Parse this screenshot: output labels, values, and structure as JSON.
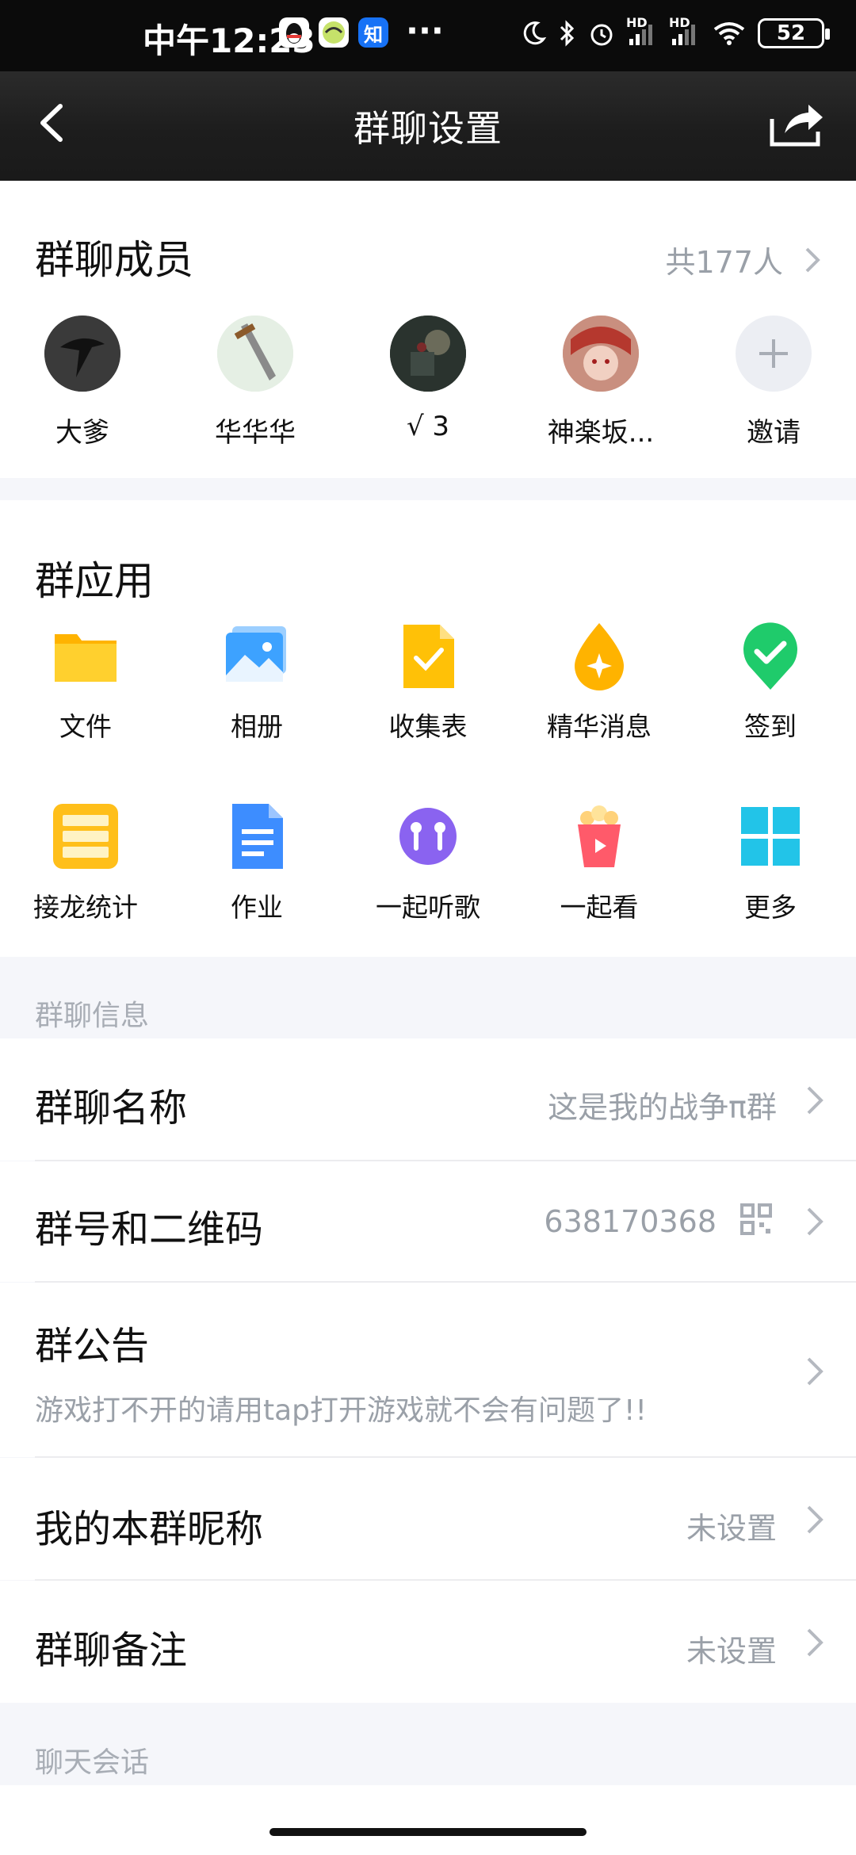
{
  "status_bar": {
    "time": "中午12:23",
    "app_icons": [
      "qq-icon",
      "app-icon",
      "zhihu-icon"
    ],
    "zhihu_glyph": "知",
    "more": "···",
    "signal1_label": "HD",
    "signal2_label": "HD",
    "battery": "52"
  },
  "header": {
    "title": "群聊设置"
  },
  "members": {
    "title": "群聊成员",
    "count": "共177人",
    "list": [
      {
        "name": "大爹"
      },
      {
        "name": "华华华"
      },
      {
        "name": "√ 3"
      },
      {
        "name": "神楽坂..."
      },
      {
        "name": "邀请"
      }
    ]
  },
  "apps": {
    "title": "群应用",
    "items": [
      {
        "label": "文件"
      },
      {
        "label": "相册"
      },
      {
        "label": "收集表"
      },
      {
        "label": "精华消息"
      },
      {
        "label": "签到"
      },
      {
        "label": "接龙统计"
      },
      {
        "label": "作业"
      },
      {
        "label": "一起听歌"
      },
      {
        "label": "一起看"
      },
      {
        "label": "更多"
      }
    ]
  },
  "group_info": {
    "label": "群聊信息",
    "rows": {
      "name_title": "群聊名称",
      "name_value": "这是我的战争π群",
      "id_title": "群号和二维码",
      "id_value": "638170368",
      "notice_title": "群公告",
      "notice_value": "游戏打不开的请用tap打开游戏就不会有问题了!!",
      "nickname_title": "我的本群昵称",
      "nickname_value": "未设置",
      "remark_title": "群聊备注",
      "remark_value": "未设置"
    }
  },
  "chat_session": {
    "label": "聊天会话"
  },
  "colors": {
    "accent_gray": "#9aa0a8",
    "folder_yellow": "#FFC107",
    "album_blue": "#3DA2FF",
    "sign_green": "#1FCB6B"
  }
}
